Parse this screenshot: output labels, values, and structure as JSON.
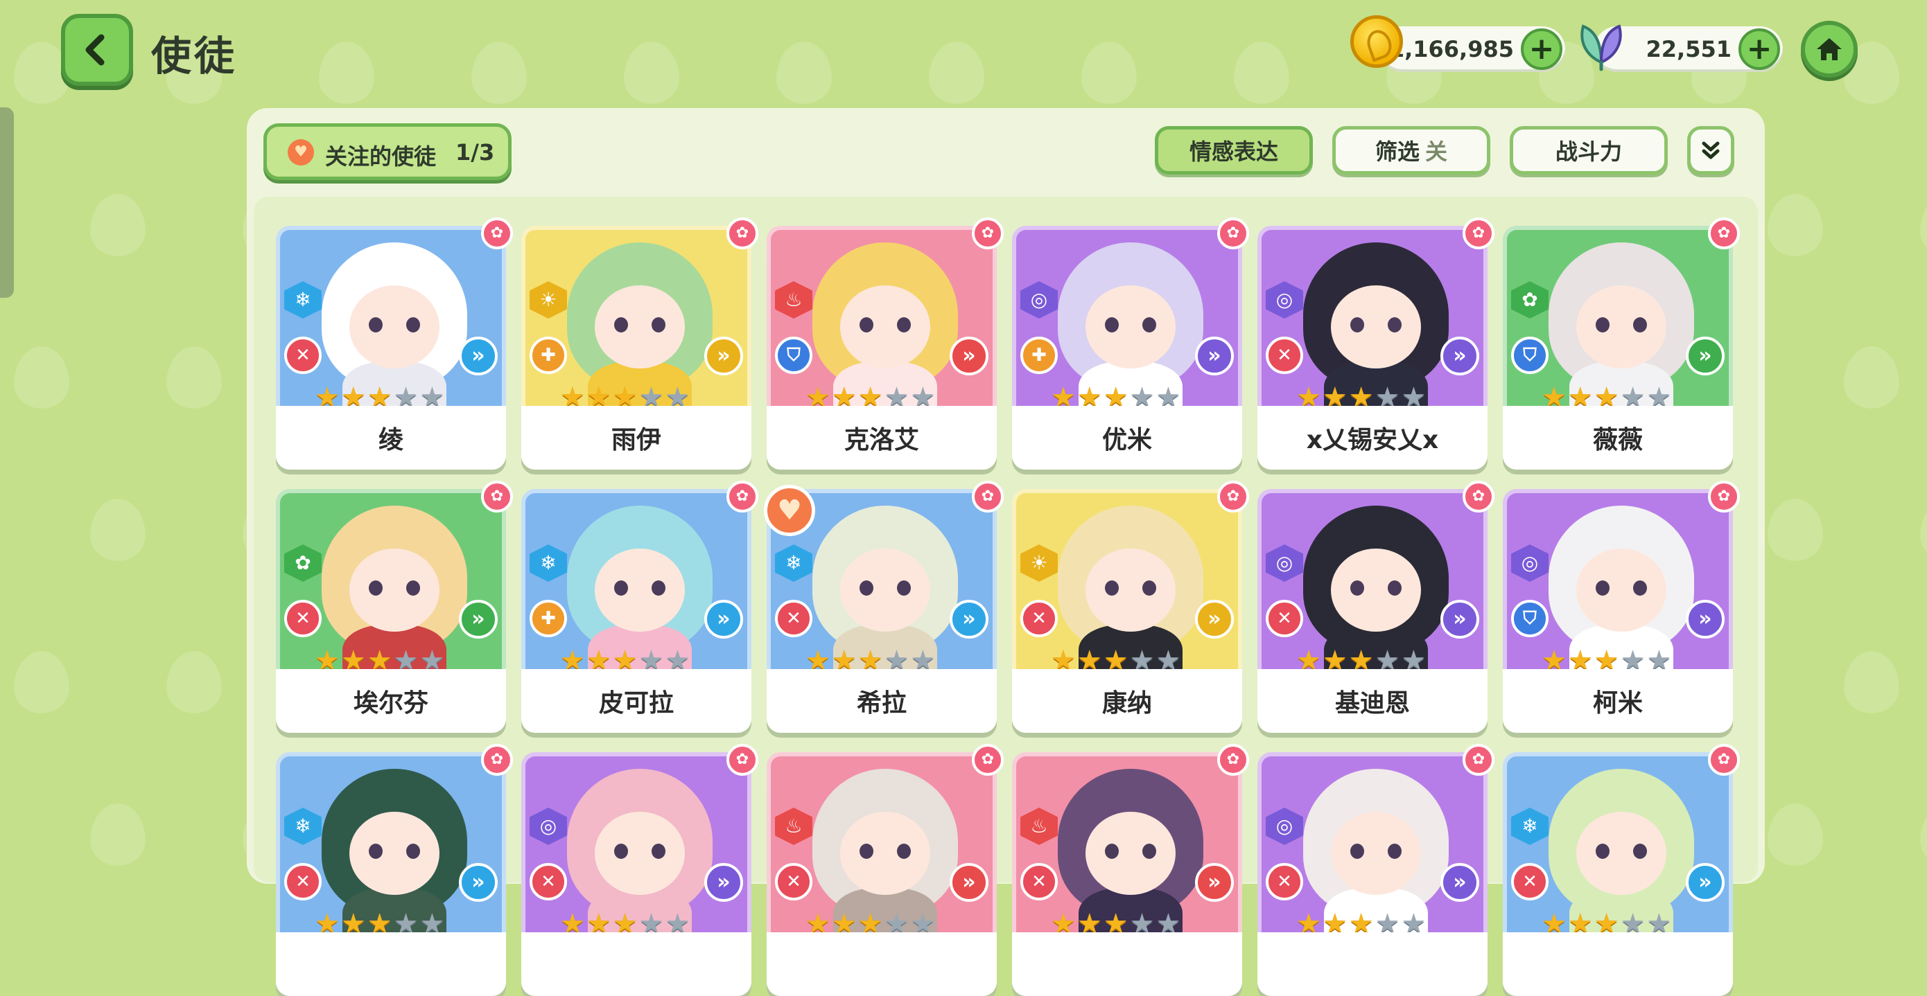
{
  "header": {
    "title": "使徒",
    "gold": "1,166,985",
    "gems": "22,551",
    "plus": "+"
  },
  "toolbar": {
    "follow_label": "关注的使徒",
    "follow_count": "1/3",
    "emotion_label": "情感表达",
    "filter_label": "筛选",
    "filter_state": "关",
    "power_label": "战斗力"
  },
  "icons": {
    "back": "chevron-left-icon",
    "home": "home-icon",
    "expand": "double-chevron-down-icon"
  },
  "colors": {
    "background": "#c4e08a",
    "accent_green": "#7dcf5a",
    "star_on": "#f5b51c",
    "star_off": "#9aa8b4",
    "favorite": "#f47a48"
  },
  "max_stars": 5,
  "characters": [
    {
      "name": "绫",
      "bg": "blue",
      "element": "ice",
      "role": "attack",
      "stars": 3,
      "favorite": false
    },
    {
      "name": "雨伊",
      "bg": "yellow",
      "element": "light",
      "role": "heal",
      "stars": 3,
      "favorite": false
    },
    {
      "name": "克洛艾",
      "bg": "pink",
      "element": "fire",
      "role": "defense",
      "stars": 3,
      "favorite": false
    },
    {
      "name": "优米",
      "bg": "purple",
      "element": "psychic",
      "role": "heal",
      "stars": 3,
      "favorite": false
    },
    {
      "name": "x乂锡安乂x",
      "bg": "purple",
      "element": "psychic",
      "role": "attack",
      "stars": 3,
      "favorite": false
    },
    {
      "name": "薇薇",
      "bg": "green",
      "element": "nature",
      "role": "defense",
      "stars": 3,
      "favorite": false
    },
    {
      "name": "埃尔芬",
      "bg": "green",
      "element": "nature",
      "role": "attack",
      "stars": 3,
      "favorite": false
    },
    {
      "name": "皮可拉",
      "bg": "blue",
      "element": "ice",
      "role": "heal",
      "stars": 3,
      "favorite": false
    },
    {
      "name": "希拉",
      "bg": "blue",
      "element": "ice",
      "role": "attack",
      "stars": 3,
      "favorite": true
    },
    {
      "name": "康纳",
      "bg": "yellow",
      "element": "light",
      "role": "attack",
      "stars": 3,
      "favorite": false
    },
    {
      "name": "基迪恩",
      "bg": "purple",
      "element": "psychic",
      "role": "attack",
      "stars": 3,
      "favorite": false
    },
    {
      "name": "柯米",
      "bg": "purple",
      "element": "psychic",
      "role": "defense",
      "stars": 3,
      "favorite": false
    },
    {
      "name": "",
      "bg": "blue",
      "element": "ice",
      "role": "attack",
      "stars": 3,
      "favorite": false
    },
    {
      "name": "",
      "bg": "purple",
      "element": "psychic",
      "role": "attack",
      "stars": 3,
      "favorite": false
    },
    {
      "name": "",
      "bg": "pink",
      "element": "fire",
      "role": "attack",
      "stars": 3,
      "favorite": false
    },
    {
      "name": "",
      "bg": "pink",
      "element": "fire",
      "role": "attack",
      "stars": 3,
      "favorite": false
    },
    {
      "name": "",
      "bg": "purple",
      "element": "psychic",
      "role": "attack",
      "stars": 3,
      "favorite": false
    },
    {
      "name": "",
      "bg": "blue",
      "element": "ice",
      "role": "attack",
      "stars": 3,
      "favorite": false
    }
  ]
}
